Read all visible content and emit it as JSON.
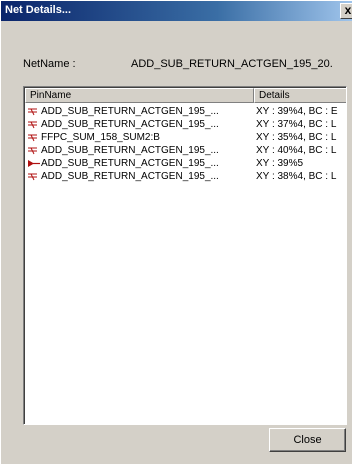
{
  "window": {
    "title": "Net Details...",
    "close_glyph": "x"
  },
  "net": {
    "label": "NetName :",
    "value": "ADD_SUB_RETURN_ACTGEN_195_20."
  },
  "list": {
    "columns": [
      "PinName",
      "Details"
    ],
    "rows": [
      {
        "icon": "pin-output-icon",
        "name": "ADD_SUB_RETURN_ACTGEN_195_...",
        "detail": "XY : 39%4, BC : E"
      },
      {
        "icon": "pin-output-icon",
        "name": "ADD_SUB_RETURN_ACTGEN_195_...",
        "detail": "XY : 37%4, BC : L"
      },
      {
        "icon": "pin-output-icon",
        "name": "FFPC_SUM_158_SUM2:B",
        "detail": "XY : 35%4, BC : L"
      },
      {
        "icon": "pin-output-icon",
        "name": "ADD_SUB_RETURN_ACTGEN_195_...",
        "detail": "XY : 40%4, BC : L"
      },
      {
        "icon": "pin-driver-icon",
        "name": "ADD_SUB_RETURN_ACTGEN_195_...",
        "detail": "XY : 39%5"
      },
      {
        "icon": "pin-output-icon",
        "name": "ADD_SUB_RETURN_ACTGEN_195_...",
        "detail": "XY : 38%4, BC : L"
      }
    ]
  },
  "buttons": {
    "close": "Close"
  },
  "colors": {
    "pin_icon": "#b01010",
    "dialog_bg": "#d4d0c8",
    "titlebar_start": "#0a246a"
  }
}
